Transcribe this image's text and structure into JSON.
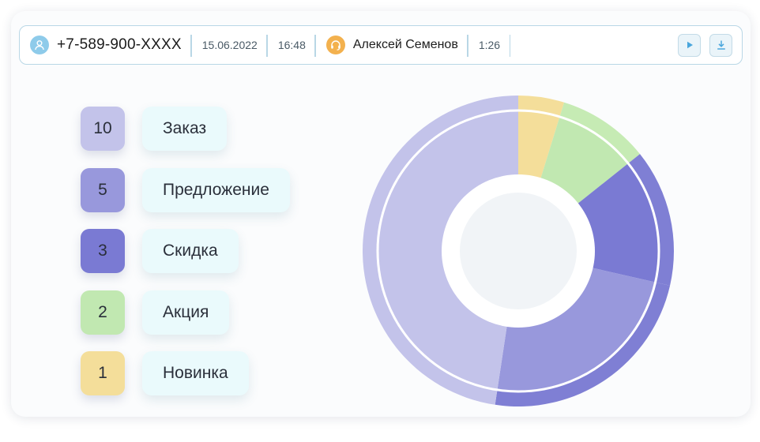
{
  "call": {
    "phone": "+7-589-900-XXXX",
    "date": "15.06.2022",
    "time": "16:48",
    "agent_name": "Алексей Семенов",
    "duration": "1:26",
    "icons": {
      "caller": "user-icon",
      "agent": "headset-icon",
      "play": "play-icon",
      "download": "download-icon"
    }
  },
  "chart_data": {
    "type": "pie",
    "categories": [
      "Заказ",
      "Предложение",
      "Скидка",
      "Акция",
      "Новинка"
    ],
    "values": [
      10,
      5,
      3,
      2,
      1
    ],
    "colors": [
      "#c3c3ea",
      "#9898dc",
      "#7a7ad3",
      "#c1e8b1",
      "#f4de9a"
    ],
    "outer_ring_colors": [
      "#c3c3ea",
      "#7f7fd4",
      "#7f7fd4",
      "#c6ebb4",
      "#f4de9a"
    ]
  },
  "colors": {
    "caller_icon_bg": "#8ecbea",
    "agent_icon_bg": "#f3b14e",
    "accent": "#b9d7e6",
    "action_icon": "#4aa6dc"
  }
}
